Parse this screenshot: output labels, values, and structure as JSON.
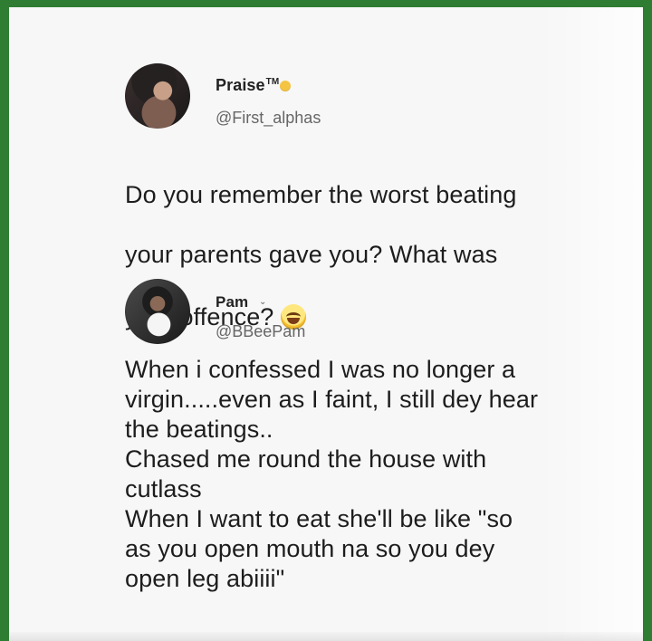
{
  "posts": [
    {
      "name": "Praise",
      "name_suffix": "TM",
      "handle": "@First_alphas",
      "text_line_1": "Do you remember the worst beating",
      "text_line_2": "your parents gave you? What was",
      "text_line_3": "your offence?"
    },
    {
      "name": "Pam",
      "handle": "@BBeePam",
      "text": "When i confessed I was no longer a\nvirgin.....even as I faint, I still dey hear\nthe beatings..\nChased me round the house with\ncutlass\nWhen I want to eat she'll be like \"so\nas you open mouth na so you dey\nopen leg abiiii\""
    }
  ],
  "icons": {
    "praise_badge": "laughing-face",
    "reply_badge": "laughing-face",
    "pam_marker": "caret-down"
  },
  "colors": {
    "frame": "#2f7d32",
    "card": "#f7f7f7",
    "text": "#1d1d1d",
    "muted": "#666666"
  }
}
